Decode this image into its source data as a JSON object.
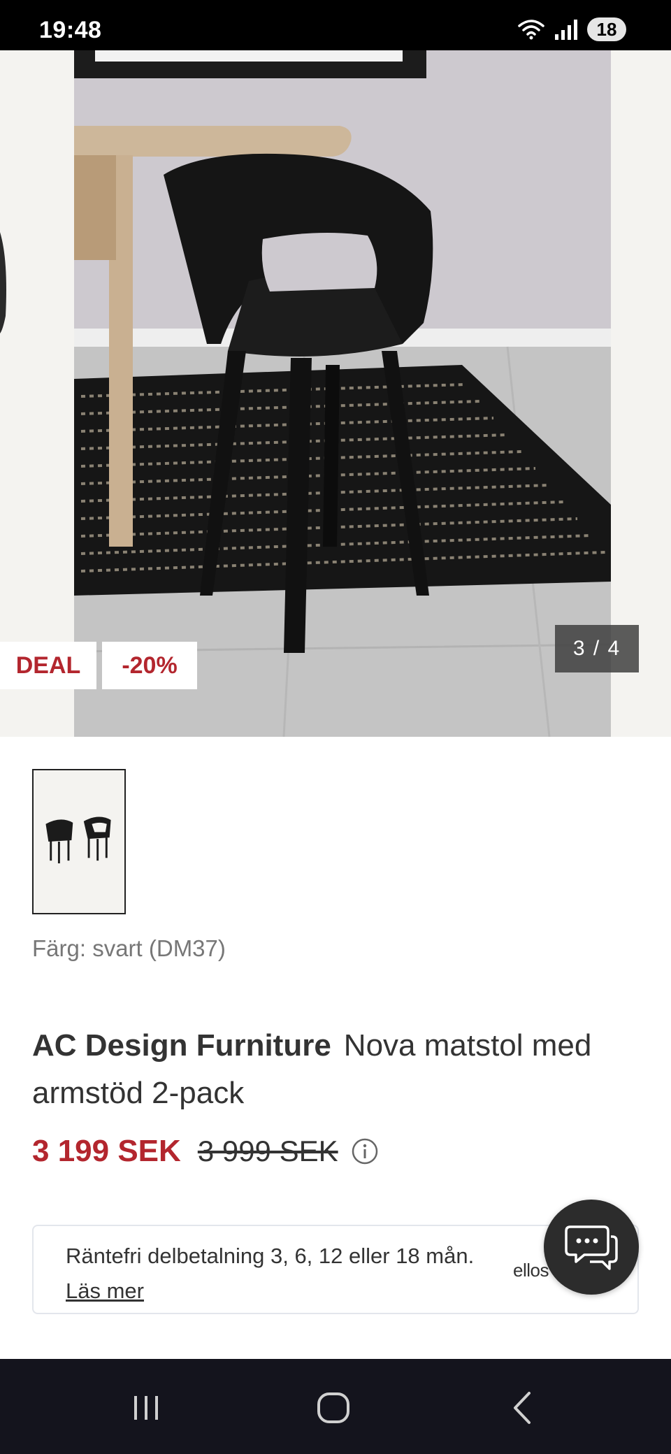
{
  "status_bar": {
    "time": "19:48",
    "battery": "18",
    "icons": [
      "wifi-icon",
      "signal-icon"
    ]
  },
  "gallery": {
    "counter": "3 / 4",
    "badges": {
      "deal": "DEAL",
      "discount": "-20%"
    }
  },
  "product": {
    "color_label": "Färg: svart (DM37)",
    "brand": "AC Design Furniture",
    "name": "Nova matstol med armstöd 2-pack",
    "price_sale": "3 199 SEK",
    "price_original": "3 999 SEK"
  },
  "payment": {
    "text": "Räntefri delbetalning 3, 6, 12 eller 18 mån.",
    "link": "Läs mer",
    "logo": "ellos"
  },
  "colors": {
    "accent_red": "#b3262e",
    "status_bar": "#000000",
    "nav_bar": "#14141d",
    "chat_button": "#2c2c2c"
  },
  "icons": {
    "chat": "chat-bubbles-icon",
    "info": "info-icon",
    "nav": [
      "recent-apps-icon",
      "home-icon",
      "back-icon"
    ]
  }
}
